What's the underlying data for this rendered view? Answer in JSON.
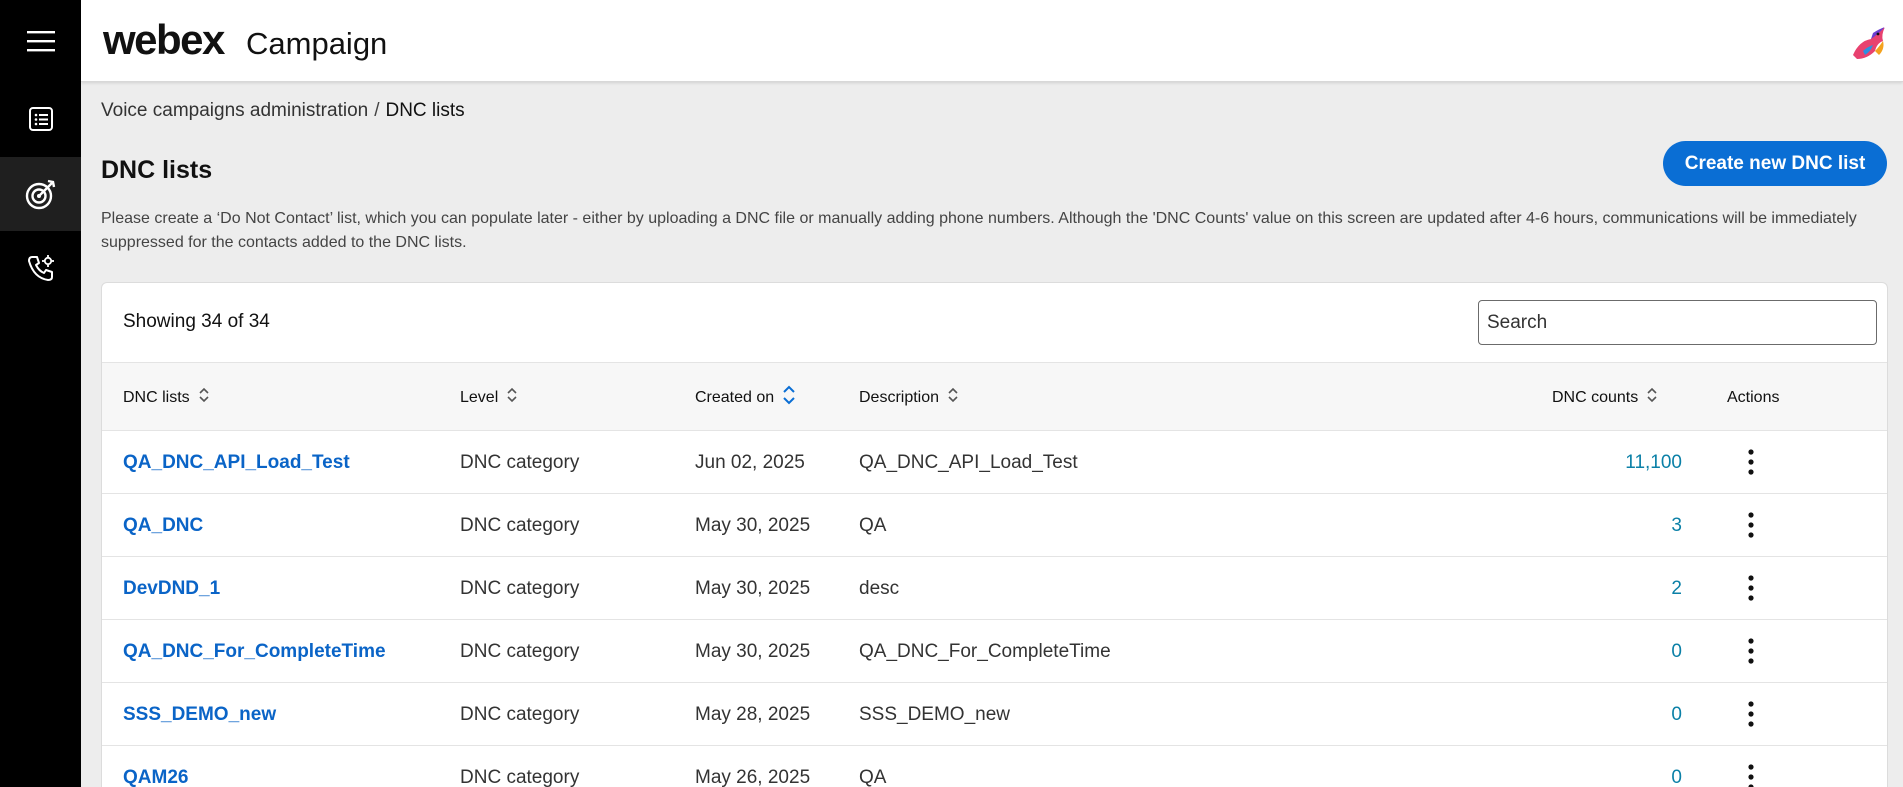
{
  "header": {
    "logo": "webex",
    "product": "Campaign"
  },
  "sidebar": {
    "items": [
      {
        "icon": "hamburger-menu-icon"
      },
      {
        "icon": "list-document-icon"
      },
      {
        "icon": "target-icon",
        "active": true
      },
      {
        "icon": "phone-settings-icon"
      }
    ]
  },
  "breadcrumb": {
    "parent": "Voice campaigns administration",
    "separator": "/",
    "current": "DNC lists"
  },
  "page": {
    "title": "DNC lists",
    "create_label": "Create new DNC list",
    "description": "Please create a ‘Do Not Contact’ list, which you can populate later - either by uploading a DNC file or manually adding phone numbers. Although the 'DNC Counts' value on this screen are updated after 4-6 hours, communications will be immediately suppressed for the contacts added to the DNC lists."
  },
  "table": {
    "showing": "Showing 34 of 34",
    "search_placeholder": "Search",
    "columns": {
      "name": "DNC lists",
      "level": "Level",
      "created": "Created on",
      "description": "Description",
      "count": "DNC counts",
      "actions": "Actions"
    },
    "rows": [
      {
        "name": "QA_DNC_API_Load_Test",
        "level": "DNC category",
        "created": "Jun 02, 2025",
        "description": "QA_DNC_API_Load_Test",
        "count": "11,100"
      },
      {
        "name": "QA_DNC",
        "level": "DNC category",
        "created": "May 30, 2025",
        "description": "QA",
        "count": "3"
      },
      {
        "name": "DevDND_1",
        "level": "DNC category",
        "created": "May 30, 2025",
        "description": "desc",
        "count": "2"
      },
      {
        "name": "QA_DNC_For_CompleteTime",
        "level": "DNC category",
        "created": "May 30, 2025",
        "description": "QA_DNC_For_CompleteTime",
        "count": "0"
      },
      {
        "name": "SSS_DEMO_new",
        "level": "DNC category",
        "created": "May 28, 2025",
        "description": "SSS_DEMO_new",
        "count": "0"
      },
      {
        "name": "QAM26",
        "level": "DNC category",
        "created": "May 26, 2025",
        "description": "QA",
        "count": "0"
      }
    ]
  },
  "colors": {
    "accent": "#0a6ed4",
    "link": "#0a64c7",
    "count": "#0b80a7",
    "sidebar": "#000000"
  }
}
